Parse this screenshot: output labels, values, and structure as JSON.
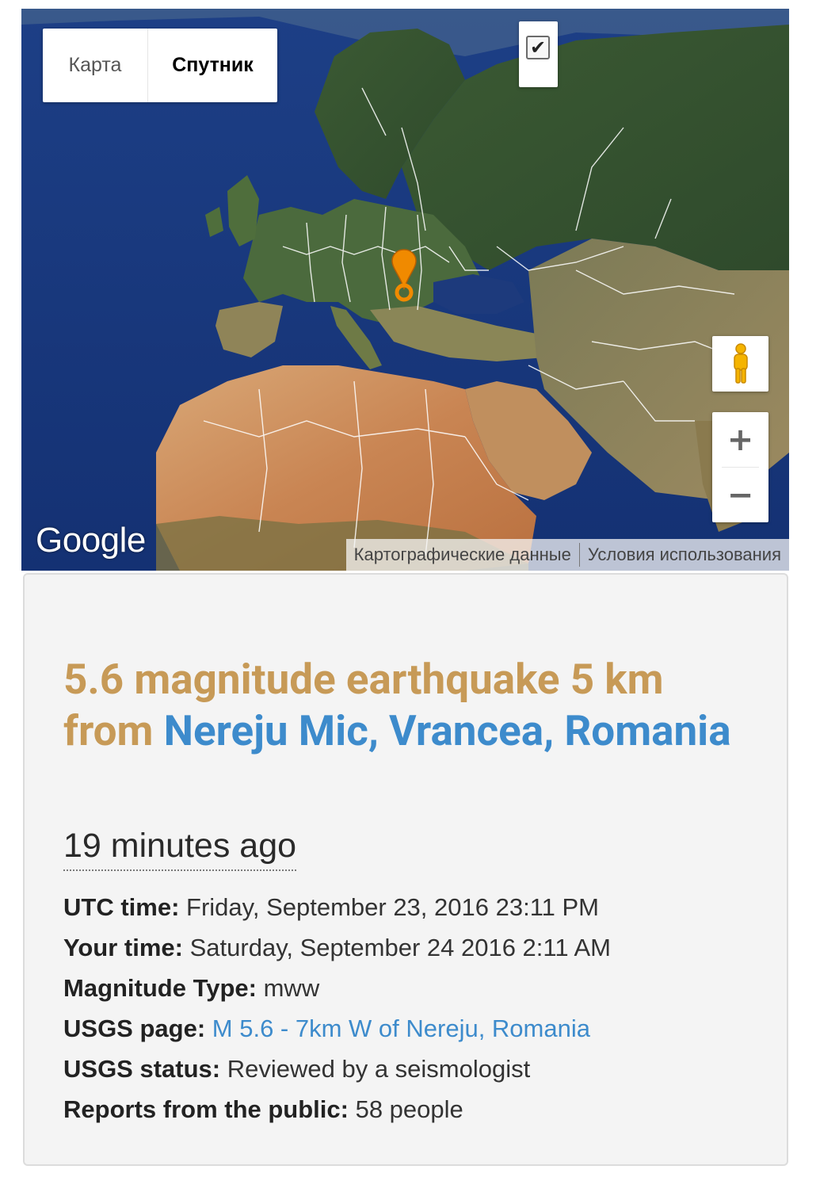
{
  "map": {
    "type_map_label": "Карта",
    "type_satellite_label": "Спутник",
    "active_type": "satellite",
    "checkbox_checked": true,
    "zoom_in_label": "+",
    "zoom_out_label": "−",
    "google_logo": "Google",
    "attribution_data": "Картографические данные",
    "attribution_terms": "Условия использования",
    "marker_color": "#f08a00"
  },
  "event": {
    "title_prefix": "5.6 magnitude earthquake 5 km from ",
    "title_place": "Nereju Mic, Vrancea, Romania",
    "time_ago": "19 minutes ago",
    "details": [
      {
        "label": "UTC time:",
        "value": "Friday, September 23, 2016 23:11 PM",
        "link": false
      },
      {
        "label": "Your time:",
        "value": "Saturday, September 24 2016 2:11 AM",
        "link": false
      },
      {
        "label": "Magnitude Type:",
        "value": "mww",
        "link": false
      },
      {
        "label": "USGS page:",
        "value": "M 5.6 - 7km W of Nereju, Romania",
        "link": true
      },
      {
        "label": "USGS status:",
        "value": "Reviewed by a seismologist",
        "link": false
      },
      {
        "label": "Reports from the public:",
        "value": "58 people",
        "link": false
      }
    ]
  },
  "colors": {
    "title_gold": "#c79a57",
    "link_blue": "#3d8bcc"
  }
}
